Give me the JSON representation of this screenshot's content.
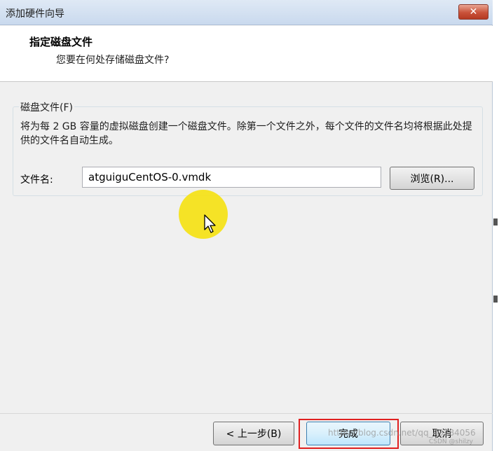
{
  "window": {
    "title": "添加硬件向导",
    "close_symbol": "✕"
  },
  "header": {
    "title": "指定磁盘文件",
    "subtitle": "您要在何处存储磁盘文件?"
  },
  "disk_file_group": {
    "legend": "磁盘文件(F)",
    "description": "将为每 2 GB 容量的虚拟磁盘创建一个磁盘文件。除第一个文件之外，每个文件的文件名均将根据此处提供的文件名自动生成。",
    "file_name_label": "文件名:",
    "file_name_value": "atguiguCentOS-0.vmdk",
    "browse_label": "浏览(R)..."
  },
  "buttons": {
    "back": "< 上一步(B)",
    "finish": "完成",
    "cancel": "取消"
  },
  "watermark": {
    "text": "https://blog.csdn.net/qq_43284056",
    "small": "CSDN @shilzy"
  },
  "colors": {
    "highlight_border": "#e02020",
    "cursor_halo": "#f4e21a"
  }
}
